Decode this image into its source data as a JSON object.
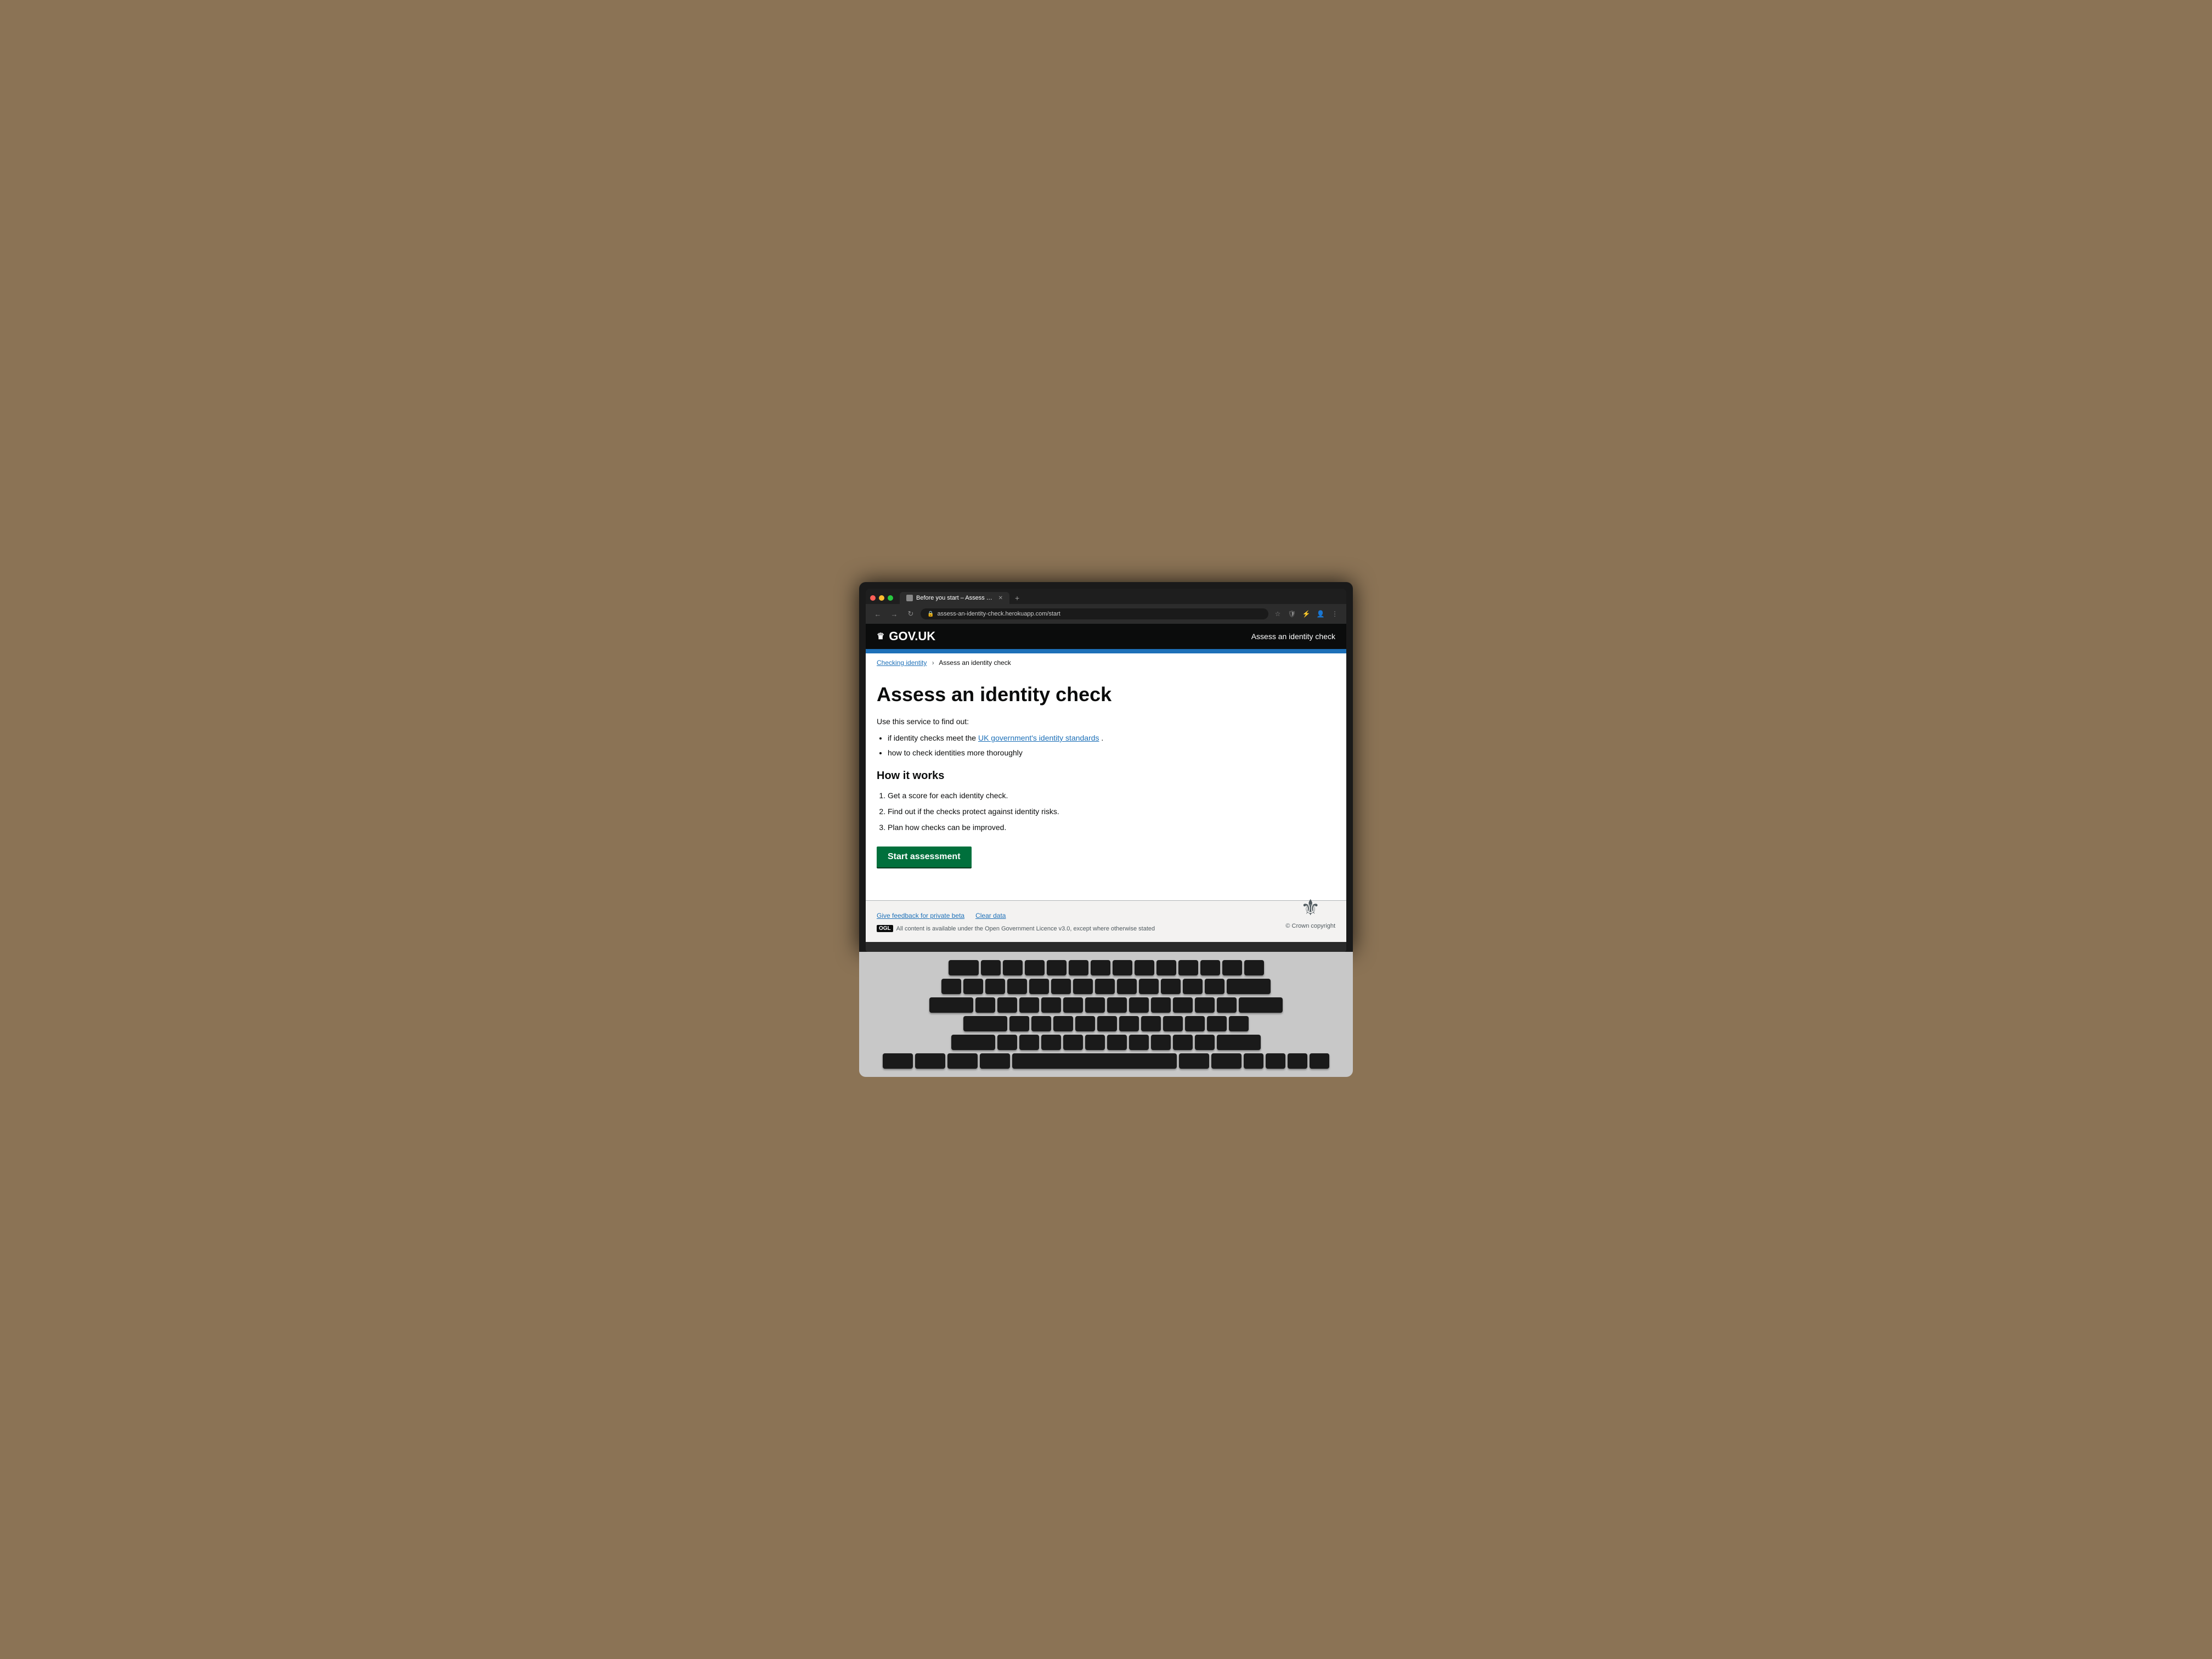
{
  "browser": {
    "tab_title": "Before you start – Assess an id",
    "url": "assess-an-identity-check.herokuapp.com/start",
    "new_tab_label": "+"
  },
  "header": {
    "logo_crown": "♛",
    "logo_text": "GOV.UK",
    "service_name": "Assess an identity check"
  },
  "breadcrumb": {
    "parent_label": "Checking identity",
    "current_label": "Assess an identity check",
    "separator": "›"
  },
  "main": {
    "page_title": "Assess an identity check",
    "intro_text": "Use this service to find out:",
    "bullets": [
      {
        "text_before": "if identity checks meet the ",
        "link_text": "UK government's identity standards",
        "text_after": "."
      },
      {
        "text": "how to check identities more thoroughly"
      }
    ],
    "how_it_works_title": "How it works",
    "steps": [
      "Get a score for each identity check.",
      "Find out if the checks protect against identity risks.",
      "Plan how checks can be improved."
    ],
    "start_button_label": "Start assessment"
  },
  "footer": {
    "feedback_link": "Give feedback for private beta",
    "clear_data_link": "Clear data",
    "licence_prefix": "OGL",
    "licence_text": "All content is available under the Open Government Licence v3.0, except where otherwise stated",
    "copyright_text": "© Crown copyright",
    "crown_symbol": "⚜"
  }
}
